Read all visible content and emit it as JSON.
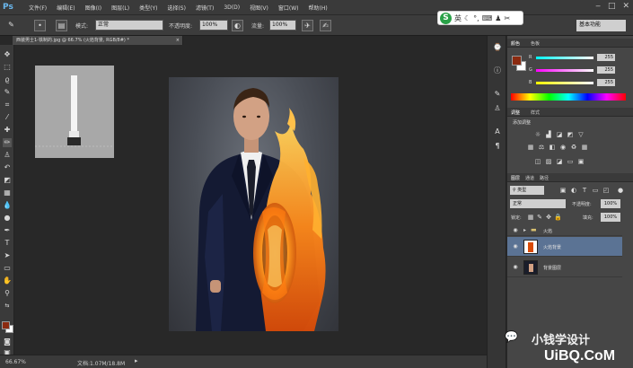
{
  "menubar": {
    "logo": "Ps",
    "items": [
      "文件(F)",
      "编辑(E)",
      "图像(I)",
      "图层(L)",
      "类型(Y)",
      "选择(S)",
      "滤镜(T)",
      "3D(D)",
      "视图(V)",
      "窗口(W)",
      "帮助(H)"
    ]
  },
  "options": {
    "mode_label": "模式:",
    "mode_value": "正常",
    "opacity_label": "不透明度:",
    "opacity_value": "100%",
    "flow_label": "流量:",
    "flow_value": "100%",
    "workspace": "基本功能"
  },
  "ime": {
    "logo": "S",
    "lang": "英"
  },
  "document": {
    "tab_title": "西装男士1-铁制的.jpg @ 66.7% (火焰背景, RGB/8#) *",
    "zoom": "66.67%",
    "doc_size": "文档:1.07M/18.8M"
  },
  "color_panel": {
    "tabs": [
      "颜色",
      "色板"
    ],
    "r_label": "R",
    "r_value": "255",
    "g_label": "G",
    "g_value": "255",
    "b_label": "B",
    "b_value": "255",
    "foreground": "#8b2a10",
    "background": "#ffffff"
  },
  "adjust_panel": {
    "tabs": [
      "调整",
      "样式"
    ],
    "title": "添加调整"
  },
  "layers_panel": {
    "tabs": [
      "图层",
      "通道",
      "路径"
    ],
    "filter_label": "类型",
    "blend_mode": "正常",
    "opacity_label": "不透明度:",
    "opacity_value": "100%",
    "lock_label": "锁定:",
    "fill_label": "填充:",
    "fill_value": "100%",
    "layers": [
      {
        "name": "火焰",
        "kind": "group"
      },
      {
        "name": "火焰背景",
        "kind": "pixel",
        "selected": true
      },
      {
        "name": "背景图层",
        "kind": "pixel"
      }
    ]
  },
  "watermark": {
    "text": "小钱学设计",
    "site": "UiBQ.CoM"
  }
}
